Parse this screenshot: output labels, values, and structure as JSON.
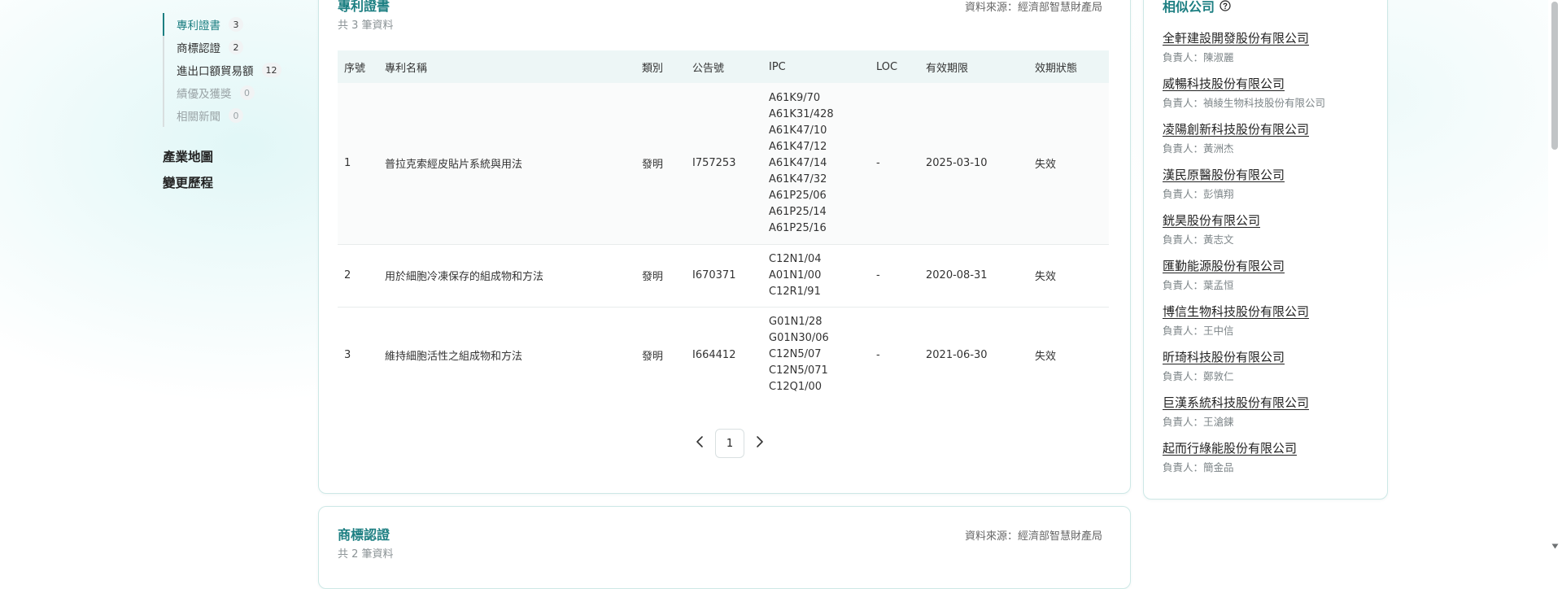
{
  "subnav": {
    "items": [
      {
        "label": "專利證書",
        "count": "3"
      },
      {
        "label": "商標認證",
        "count": "2"
      },
      {
        "label": "進出口額貿易額",
        "count": "12"
      },
      {
        "label": "績優及獲獎",
        "count": "0"
      },
      {
        "label": "相關新聞",
        "count": "0"
      }
    ]
  },
  "mainnav": {
    "industry_map": "產業地圖",
    "change_history": "變更歷程"
  },
  "patent_section": {
    "title": "專利證書",
    "subtitle": "共 3 筆資料",
    "source": "資料來源：經濟部智慧財產局",
    "columns": [
      "序號",
      "專利名稱",
      "類別",
      "公告號",
      "IPC",
      "LOC",
      "有效期限",
      "效期狀態"
    ],
    "rows": [
      {
        "no": "1",
        "name": "普拉克索經皮貼片系統與用法",
        "category": "發明",
        "pub_no": "I757253",
        "ipc": [
          "A61K9/70",
          "A61K31/428",
          "A61K47/10",
          "A61K47/12",
          "A61K47/14",
          "A61K47/32",
          "A61P25/06",
          "A61P25/14",
          "A61P25/16"
        ],
        "loc": "-",
        "expiry": "2025-03-10",
        "status": "失效"
      },
      {
        "no": "2",
        "name": "用於細胞冷凍保存的組成物和方法",
        "category": "發明",
        "pub_no": "I670371",
        "ipc": [
          "C12N1/04",
          "A01N1/00",
          "C12R1/91"
        ],
        "loc": "-",
        "expiry": "2020-08-31",
        "status": "失效"
      },
      {
        "no": "3",
        "name": "維持細胞活性之組成物和方法",
        "category": "發明",
        "pub_no": "I664412",
        "ipc": [
          "G01N1/28",
          "G01N30/06",
          "C12N5/07",
          "C12N5/071",
          "C12Q1/00"
        ],
        "loc": "-",
        "expiry": "2021-06-30",
        "status": "失效"
      }
    ],
    "pagination": {
      "current_page": "1"
    }
  },
  "trademark_section": {
    "title": "商標認證",
    "subtitle": "共 2 筆資料",
    "source": "資料來源：經濟部智慧財產局"
  },
  "similar_companies": {
    "title": "相似公司",
    "items": [
      {
        "name": "全軒建設開發股份有限公司",
        "owner": "負責人：陳淑麗"
      },
      {
        "name": "威暢科技股份有限公司",
        "owner": "負責人：禎綾生物科技股份有限公司"
      },
      {
        "name": "凌陽創新科技股份有限公司",
        "owner": "負責人：黃洲杰"
      },
      {
        "name": "漢民原醫股份有限公司",
        "owner": "負責人：彭慎翔"
      },
      {
        "name": "銧昊股份有限公司",
        "owner": "負責人：黃志文"
      },
      {
        "name": "匯勤能源股份有限公司",
        "owner": "負責人：葉孟恒"
      },
      {
        "name": "博信生物科技股份有限公司",
        "owner": "負責人：王中信"
      },
      {
        "name": "昕琦科技股份有限公司",
        "owner": "負責人：鄭敦仁"
      },
      {
        "name": "巨漢系統科技股份有限公司",
        "owner": "負責人：王滄鍊"
      },
      {
        "name": "起而行綠能股份有限公司",
        "owner": "負責人：簡金品"
      }
    ]
  },
  "colors": {
    "accent": "#1d7f82",
    "card_border": "#cde8e6",
    "table_header_bg": "#edf6f6"
  }
}
